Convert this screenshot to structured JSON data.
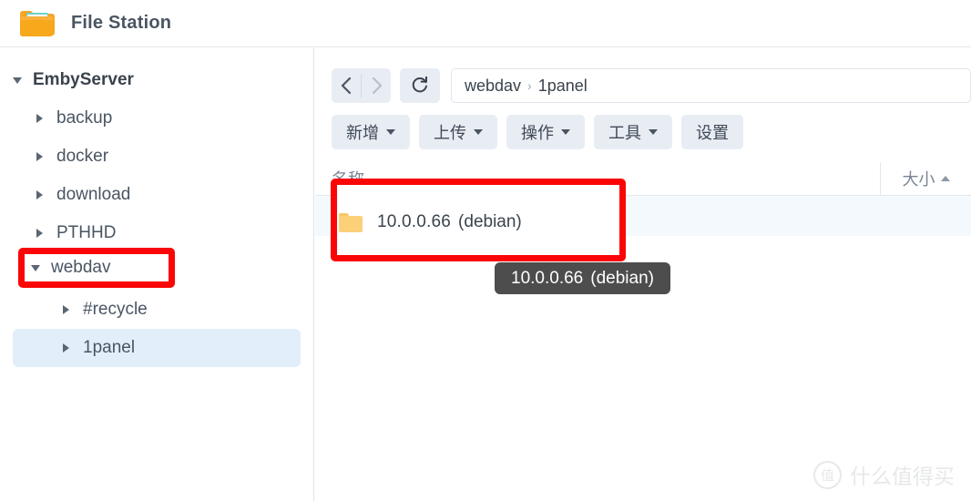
{
  "header": {
    "title": "File Station",
    "icon": "folder-icon"
  },
  "sidebar": {
    "items": [
      {
        "label": "EmbyServer",
        "level": 0,
        "expanded": true,
        "selected": false,
        "highlighted": false
      },
      {
        "label": "backup",
        "level": 1,
        "expanded": false,
        "selected": false,
        "highlighted": false
      },
      {
        "label": "docker",
        "level": 1,
        "expanded": false,
        "selected": false,
        "highlighted": false
      },
      {
        "label": "download",
        "level": 1,
        "expanded": false,
        "selected": false,
        "highlighted": false
      },
      {
        "label": "PTHHD",
        "level": 1,
        "expanded": false,
        "selected": false,
        "highlighted": false
      },
      {
        "label": "webdav",
        "level": 1,
        "expanded": true,
        "selected": false,
        "highlighted": true
      },
      {
        "label": "#recycle",
        "level": 2,
        "expanded": false,
        "selected": false,
        "highlighted": false
      },
      {
        "label": "1panel",
        "level": 2,
        "expanded": false,
        "selected": true,
        "highlighted": false
      }
    ]
  },
  "navbar": {
    "back_icon": "chevron-left-icon",
    "forward_icon": "chevron-right-icon",
    "refresh_icon": "refresh-icon",
    "breadcrumb": [
      "webdav",
      "1panel"
    ],
    "breadcrumb_separator": "›"
  },
  "toolbar": {
    "buttons": [
      {
        "label": "新增",
        "has_caret": true
      },
      {
        "label": "上传",
        "has_caret": true
      },
      {
        "label": "操作",
        "has_caret": true
      },
      {
        "label": "工具",
        "has_caret": true
      },
      {
        "label": "设置",
        "has_caret": false
      }
    ]
  },
  "file_table": {
    "columns": {
      "name": "名称",
      "size": "大小",
      "size_sort": "ascending"
    },
    "rows": [
      {
        "icon": "folder-icon",
        "name": "10.0.0.66",
        "suffix": "(debian)",
        "size": ""
      }
    ]
  },
  "tooltip": {
    "name": "10.0.0.66",
    "suffix": "(debian)"
  },
  "annotations": {
    "sidebar_box_target": "webdav",
    "file_box_target": "10.0.0.66 (debian)",
    "box_color": "#fb0606"
  },
  "watermark": {
    "badge": "值",
    "text": "什么值得买"
  }
}
